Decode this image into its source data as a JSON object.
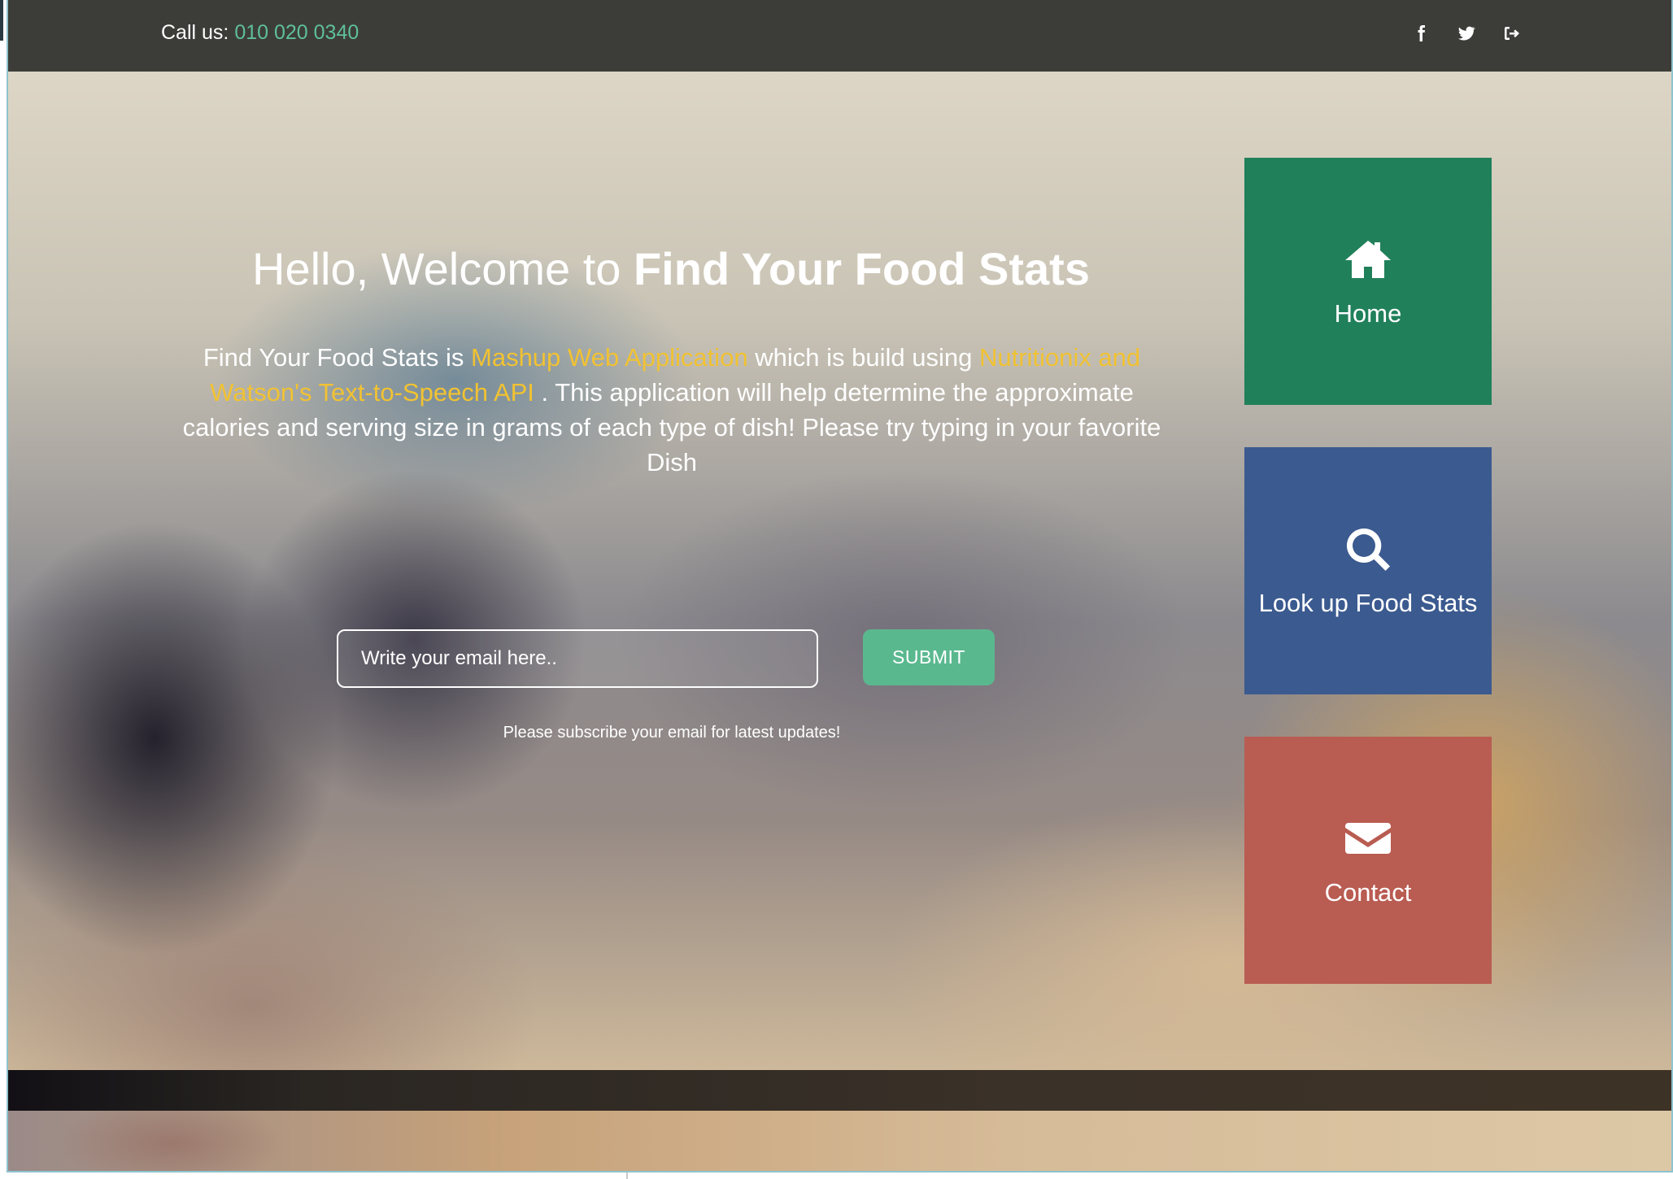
{
  "topbar": {
    "call_label": "Call us:",
    "phone": "010 020 0340",
    "social": [
      {
        "icon": "facebook-icon"
      },
      {
        "icon": "twitter-icon"
      },
      {
        "icon": "sign-out-icon"
      }
    ]
  },
  "hero": {
    "title_prefix": "Hello, Welcome to ",
    "title_bold": "Find Your Food Stats",
    "desc_part1": "Find Your Food Stats is ",
    "desc_hl1": "Mashup Web Application",
    "desc_part2": " which is build using ",
    "desc_hl2": "Nutritionix and Watson's Text-to-Speech API",
    "desc_part3": " . This application will help determine the approximate calories and serving size in grams of each type of dish! Please try typing in your favorite Dish",
    "highlight_color": "#f1c232"
  },
  "subscribe": {
    "placeholder": "Write your email here..",
    "submit_label": "SUBMIT",
    "note": "Please subscribe your email for latest updates!"
  },
  "tiles": [
    {
      "label": "Home",
      "icon": "home-icon",
      "color": "#20805a"
    },
    {
      "label": "Look up Food Stats",
      "icon": "search-icon",
      "color": "#3b5a8f"
    },
    {
      "label": "Contact",
      "icon": "envelope-icon",
      "color": "#b95c52"
    }
  ]
}
